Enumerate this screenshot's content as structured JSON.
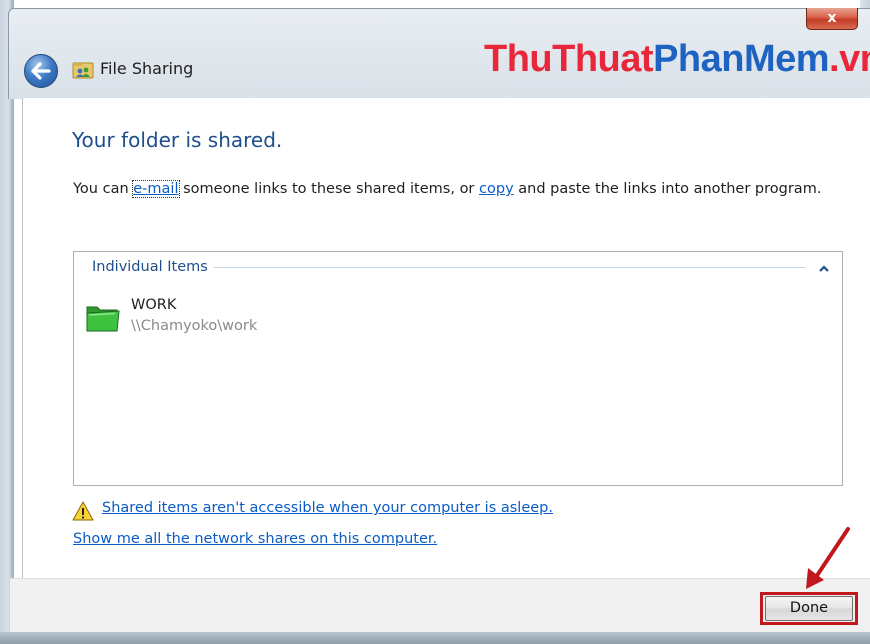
{
  "window": {
    "title": "File Sharing",
    "close_glyph": "x",
    "back_icon": "back-arrow-icon"
  },
  "watermark": {
    "part1": "ThuThuat",
    "part2": "PhanMem",
    "part3": ".vn",
    "colors": {
      "red": "#e8283a",
      "blue": "#1e63c2"
    }
  },
  "main": {
    "heading": "Your folder is shared.",
    "desc_prefix": "You can ",
    "email_link": "e-mail",
    "desc_middle": " someone links to these shared items, or ",
    "copy_link": "copy",
    "desc_suffix": " and paste the links into another program."
  },
  "items_panel": {
    "group_label": "Individual Items",
    "items": [
      {
        "name": "WORK",
        "path": "\\\\Chamyoko\\work",
        "icon": "folder-icon"
      }
    ]
  },
  "links": {
    "asleep_warning": "Shared items aren't accessible when your computer is asleep.",
    "network_shares": "Show me all the network shares on this computer."
  },
  "footer": {
    "done_label": "Done"
  },
  "colors": {
    "heading": "#1e4e8c",
    "link": "#0a5cc4",
    "highlight": "#c0181c"
  }
}
